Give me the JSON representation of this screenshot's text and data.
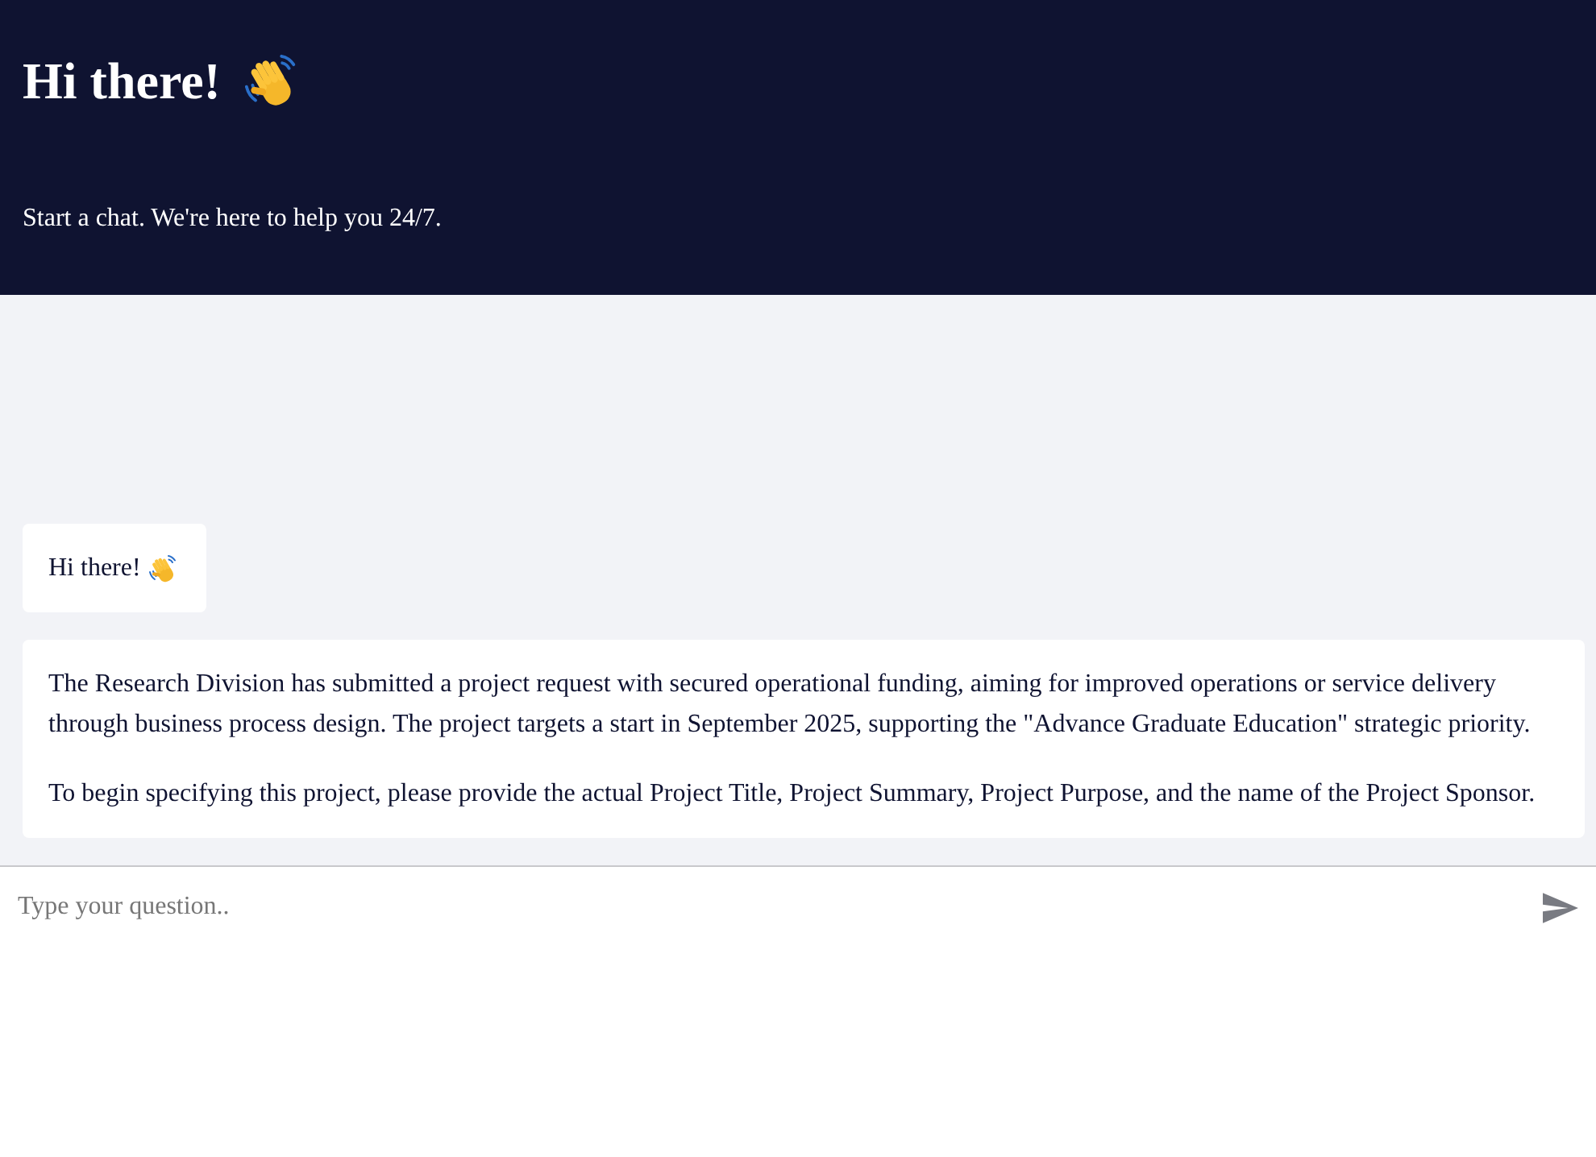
{
  "header": {
    "title": "Hi there!",
    "subtitle": "Start a chat. We're here to help you 24/7."
  },
  "messages": [
    {
      "kind": "greeting",
      "paragraphs": [
        "Hi there!"
      ]
    },
    {
      "kind": "text",
      "paragraphs": [
        "The Research Division has submitted a project request with secured operational funding, aiming for improved operations or service delivery through business process design. The project targets a start in September 2025, supporting the \"Advance Graduate Education\" strategic priority.",
        "To begin specifying this project, please provide the actual Project Title, Project Summary, Project Purpose, and the name of the Project Sponsor."
      ]
    }
  ],
  "composer": {
    "placeholder": "Type your question.."
  }
}
